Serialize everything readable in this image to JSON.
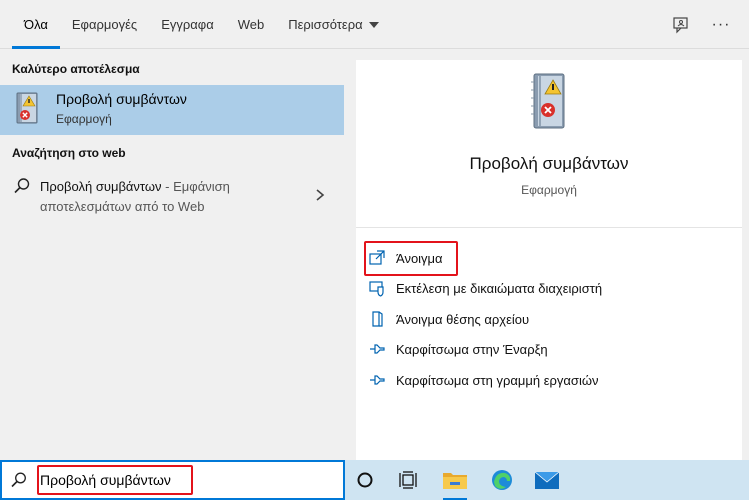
{
  "tabs": [
    {
      "label": "Όλα",
      "active": true
    },
    {
      "label": "Εφαρμογές",
      "active": false
    },
    {
      "label": "Εγγραφα",
      "active": false
    },
    {
      "label": "Web",
      "active": false
    },
    {
      "label": "Περισσότερα",
      "active": false
    }
  ],
  "topbar": {
    "more_glyph": "···"
  },
  "left": {
    "best_match_header": "Καλύτερο αποτέλεσμα",
    "best_match": {
      "title": "Προβολή συμβάντων",
      "subtitle": "Εφαρμογή"
    },
    "web_header": "Αναζήτηση στο web",
    "web_result": {
      "term": "Προβολή συμβάντων",
      "dash": " - ",
      "desc_line1": "Εμφάνιση",
      "desc_line2": "αποτελεσμάτων από το Web"
    }
  },
  "detail": {
    "app_name": "Προβολή συμβάντων",
    "app_kind": "Εφαρμογή",
    "actions": [
      {
        "label": "Άνοιγμα",
        "icon": "open-icon"
      },
      {
        "label": "Εκτέλεση με δικαιώματα διαχειριστή",
        "icon": "admin-shield-icon"
      },
      {
        "label": "Άνοιγμα θέσης αρχείου",
        "icon": "file-location-icon"
      },
      {
        "label": "Καρφίτσωμα στην Έναρξη",
        "icon": "pin-icon"
      },
      {
        "label": "Καρφίτσωμα στη γραμμή εργασιών",
        "icon": "pin-icon"
      }
    ]
  },
  "taskbar": {
    "search_value": "Προβολή συμβάντων",
    "icons": [
      "cortana-icon",
      "task-view-icon",
      "file-explorer-icon",
      "edge-icon",
      "mail-icon"
    ]
  },
  "colors": {
    "accent": "#0078d7",
    "selection": "#abcde8",
    "highlight_box": "#e3131b",
    "taskbar": "#cfe4f2"
  }
}
